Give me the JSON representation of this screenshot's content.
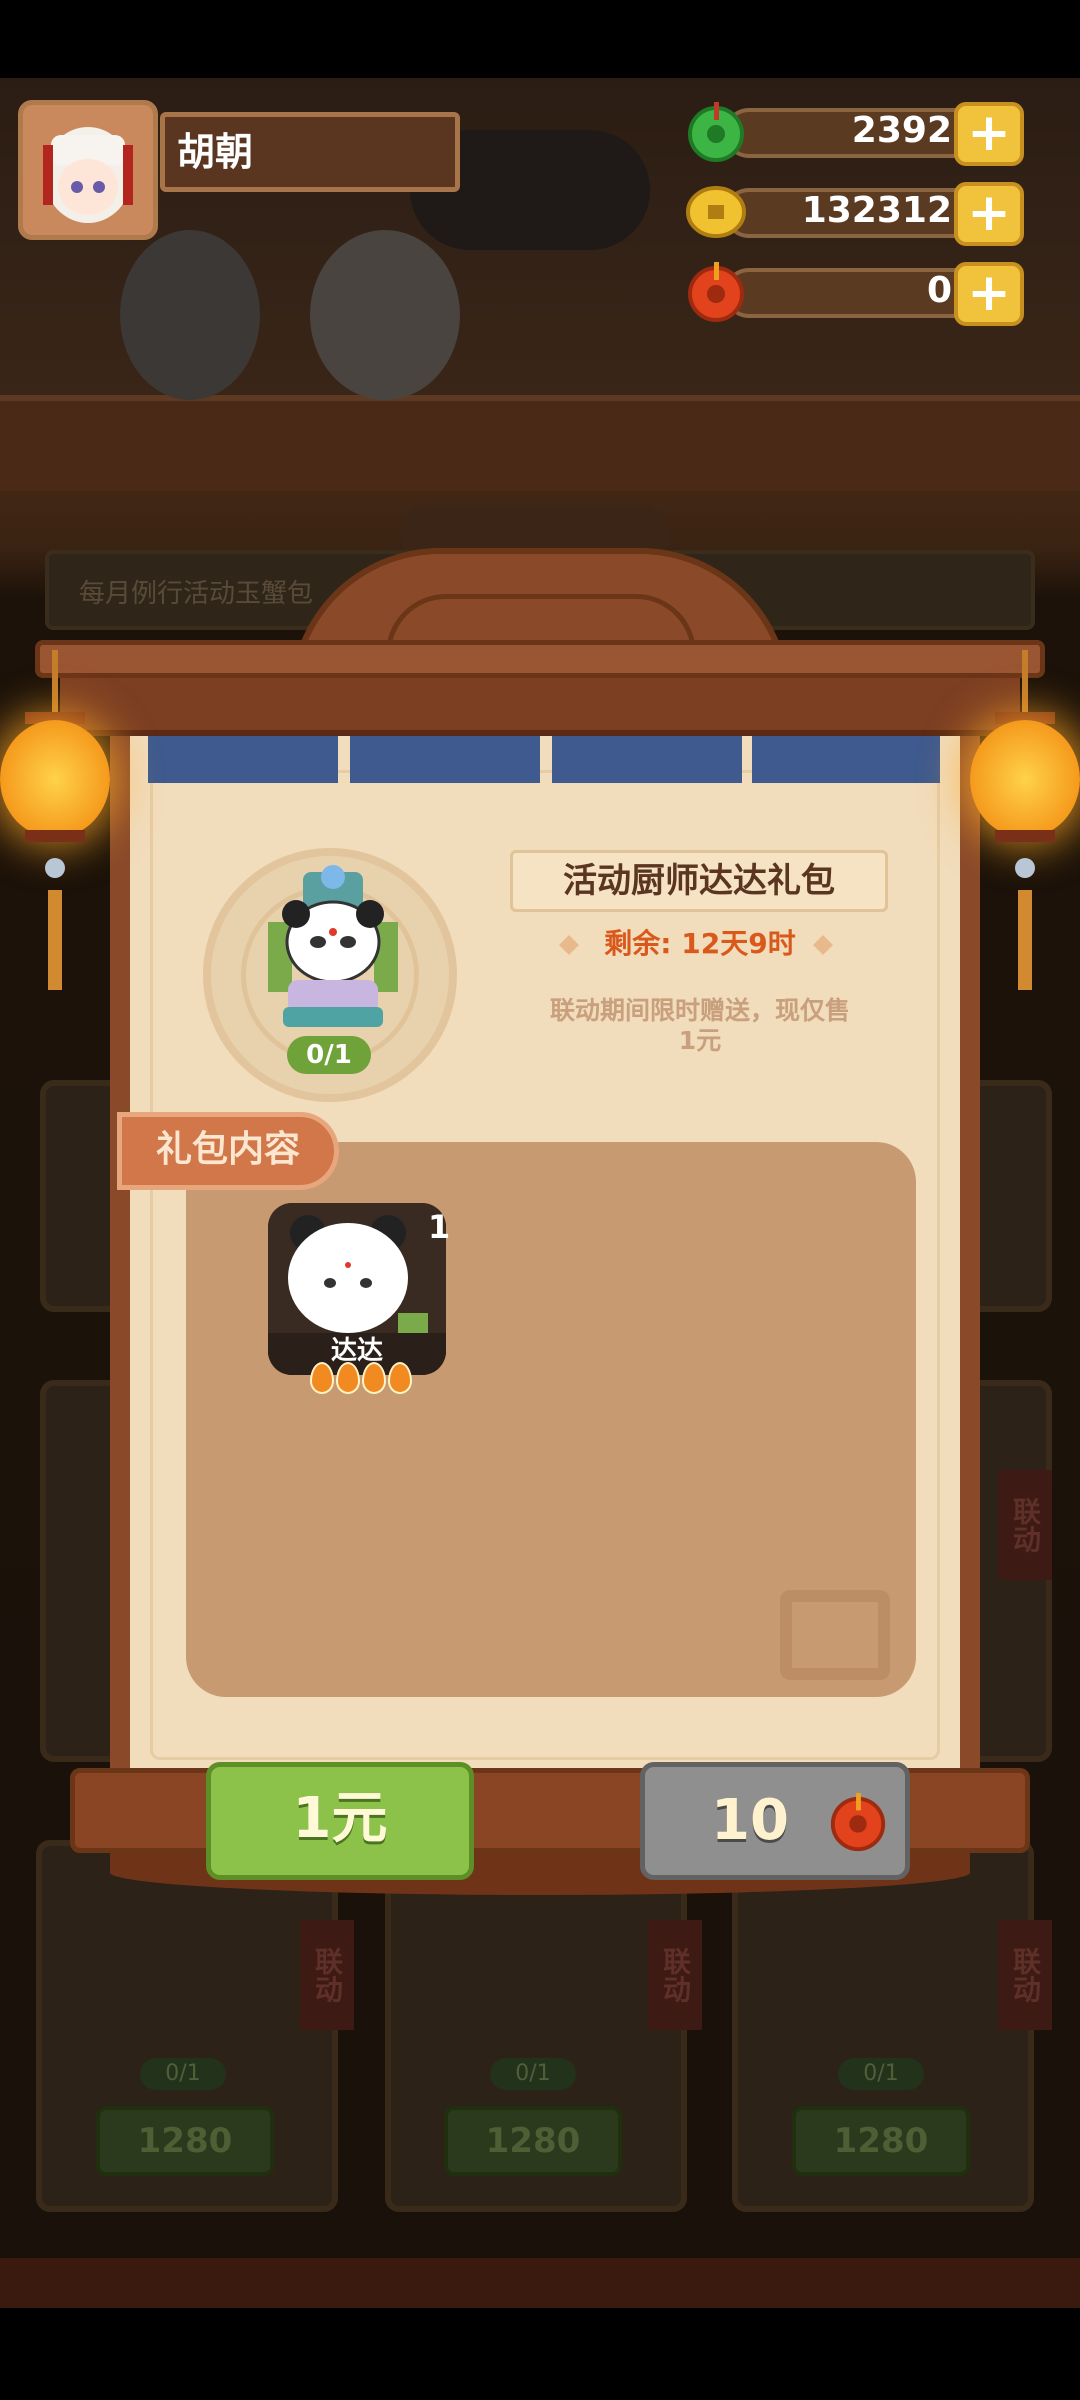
{
  "player": {
    "name": "胡朝"
  },
  "resources": [
    {
      "icon": "green-jade-icon",
      "value": "2392",
      "color": "#3cb545"
    },
    {
      "icon": "gold-coin-icon",
      "value": "132312",
      "color": "#e8b224"
    },
    {
      "icon": "red-jade-icon",
      "value": "0",
      "color": "#e2421c"
    }
  ],
  "background": {
    "banner_text": "每月例行活动玉蟹包",
    "side_tags": [
      "联动",
      "联动",
      "联动",
      "联动"
    ],
    "card_counts": [
      "0/1",
      "0/1",
      "0/1"
    ],
    "card_prices": [
      "1280",
      "1280",
      "1280"
    ]
  },
  "gift_pack": {
    "title": "活动厨师达达礼包",
    "remaining": "剩余: 12天9时",
    "description": "联动期间限时赠送，现仅售1元",
    "portrait_count": "0/1",
    "content_label": "礼包内容",
    "item": {
      "name": "达达",
      "quantity": "1",
      "stars": 4
    },
    "buy_price_label": "1元",
    "alt_price_value": "10",
    "alt_price_icon": "red-jade-icon"
  },
  "colors": {
    "buy_button": "#8cc24a",
    "alt_button": "#8f8f8f",
    "accent_orange": "#d9591c"
  }
}
